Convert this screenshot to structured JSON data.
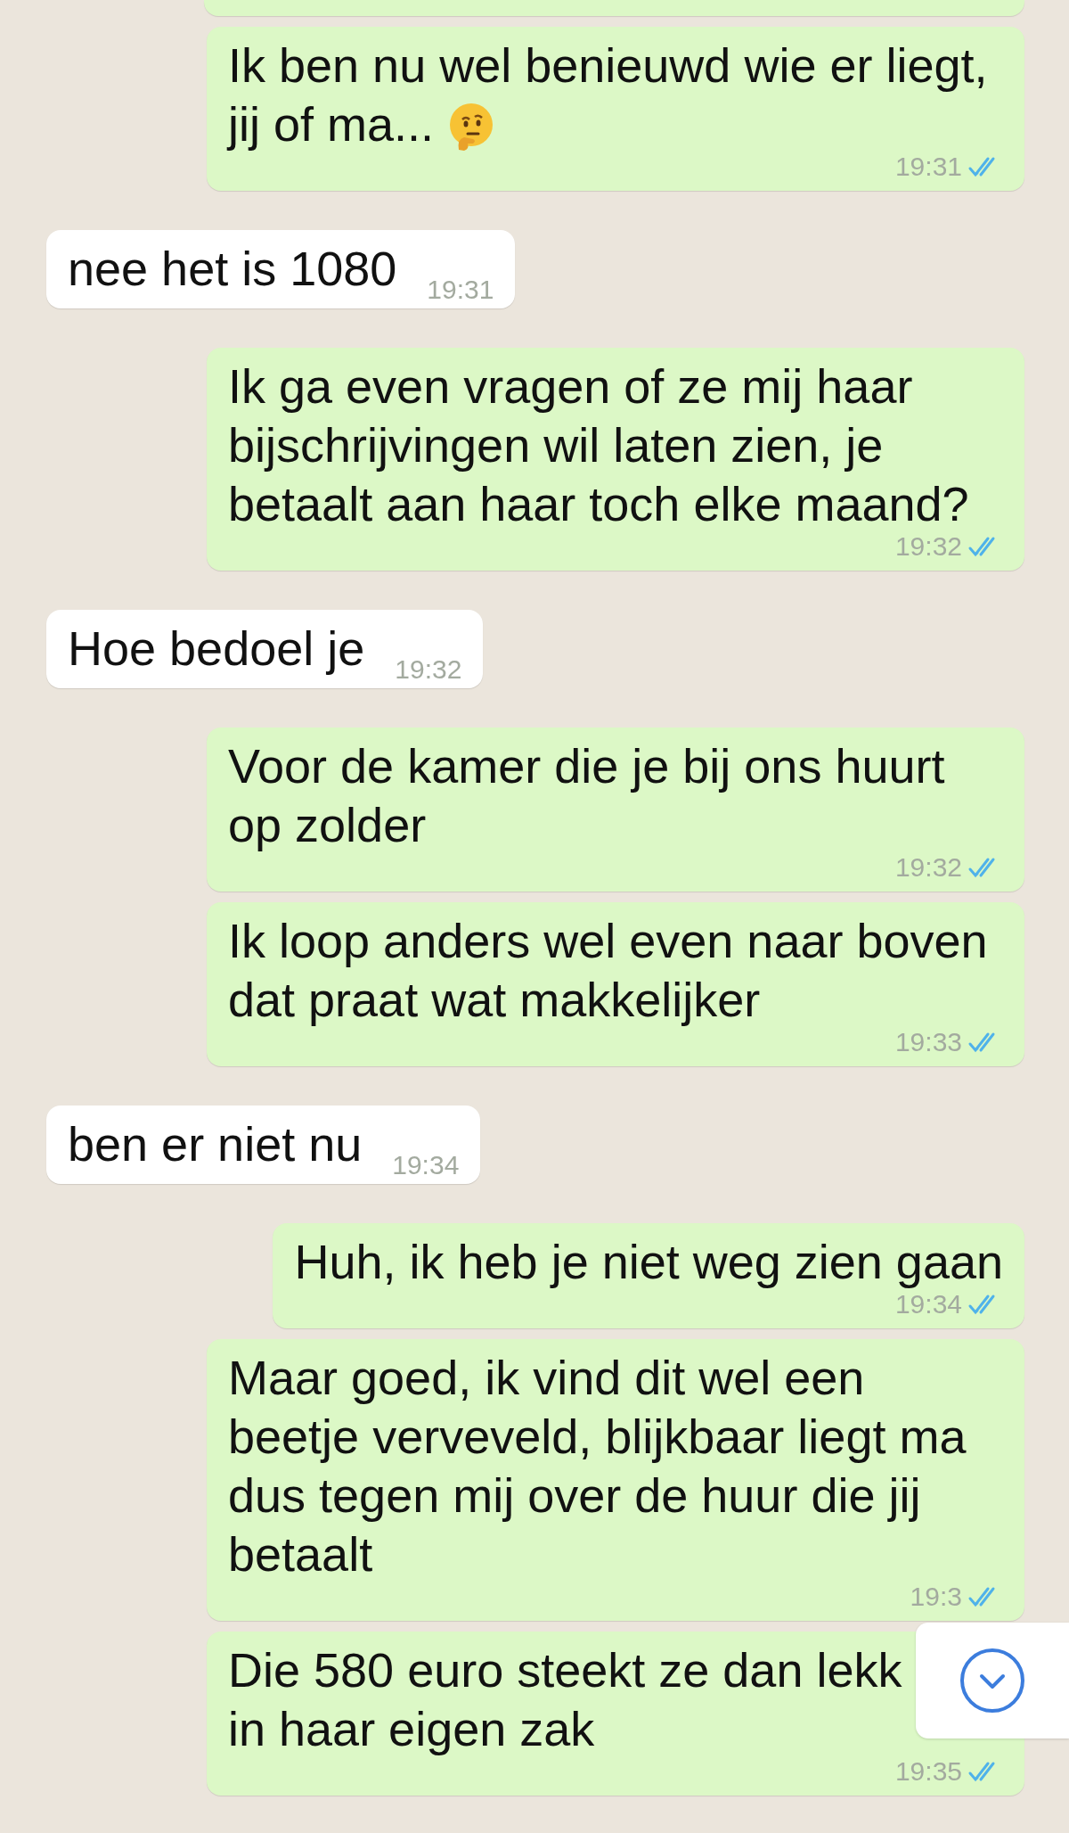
{
  "messages": [
    {
      "outgoing": true,
      "kind": "cut"
    },
    {
      "outgoing": true,
      "kind": "text",
      "text": "Ik ben nu wel benieuwd wie er liegt, jij of ma...",
      "emoji": true,
      "time": "19:31",
      "read": true
    },
    {
      "outgoing": false,
      "kind": "text",
      "text": "nee het is 1080",
      "time": "19:31"
    },
    {
      "outgoing": true,
      "kind": "text",
      "text": "Ik ga even vragen of ze mij haar bijschrijvingen wil laten zien, je betaalt aan haar toch elke maand?",
      "time": "19:32",
      "read": true
    },
    {
      "outgoing": false,
      "kind": "text",
      "text": "Hoe bedoel je",
      "time": "19:32"
    },
    {
      "outgoing": true,
      "kind": "text",
      "text": "Voor de kamer die je bij ons huurt op zolder",
      "time": "19:32",
      "read": true
    },
    {
      "outgoing": true,
      "kind": "text",
      "text": "Ik loop anders wel even naar boven dat praat wat makkelijker",
      "time": "19:33",
      "read": true
    },
    {
      "outgoing": false,
      "kind": "text",
      "text": "ben er niet nu",
      "time": "19:34"
    },
    {
      "outgoing": true,
      "kind": "text",
      "text": "Huh, ik heb je niet weg zien gaan",
      "time": "19:34",
      "read": true
    },
    {
      "outgoing": true,
      "kind": "text",
      "text": "Maar goed, ik vind dit wel een beetje verveveld, blijkbaar liegt ma dus tegen mij over de huur die jij betaalt",
      "time": "19:3",
      "read": true
    },
    {
      "outgoing": true,
      "kind": "text",
      "text": "Die 580 euro steekt ze dan lekk in haar eigen zak",
      "time": "19:35",
      "read": true
    }
  ],
  "scroll_down_button": {
    "visible": true
  }
}
